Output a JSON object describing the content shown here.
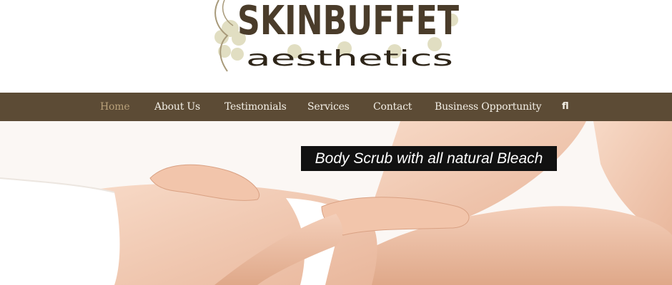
{
  "brand": {
    "name": "SKINBUFFET",
    "tagline": "aesthetics"
  },
  "nav": {
    "items": [
      {
        "label": "Home",
        "active": true
      },
      {
        "label": "About Us",
        "active": false
      },
      {
        "label": "Testimonials",
        "active": false
      },
      {
        "label": "Services",
        "active": false
      },
      {
        "label": "Contact",
        "active": false
      },
      {
        "label": "Business Opportunity",
        "active": false
      }
    ],
    "search_glyph": "fl",
    "search_icon": "search-icon"
  },
  "hero": {
    "caption": "Body Scrub with all natural Bleach"
  },
  "colors": {
    "nav_bar": "#5c4b35",
    "nav_text": "#f3efe6",
    "nav_active": "#b8a07a",
    "logo_text": "#4a3c2a",
    "logo_flowers": "#dcd9b8",
    "caption_bg": "#111111"
  }
}
